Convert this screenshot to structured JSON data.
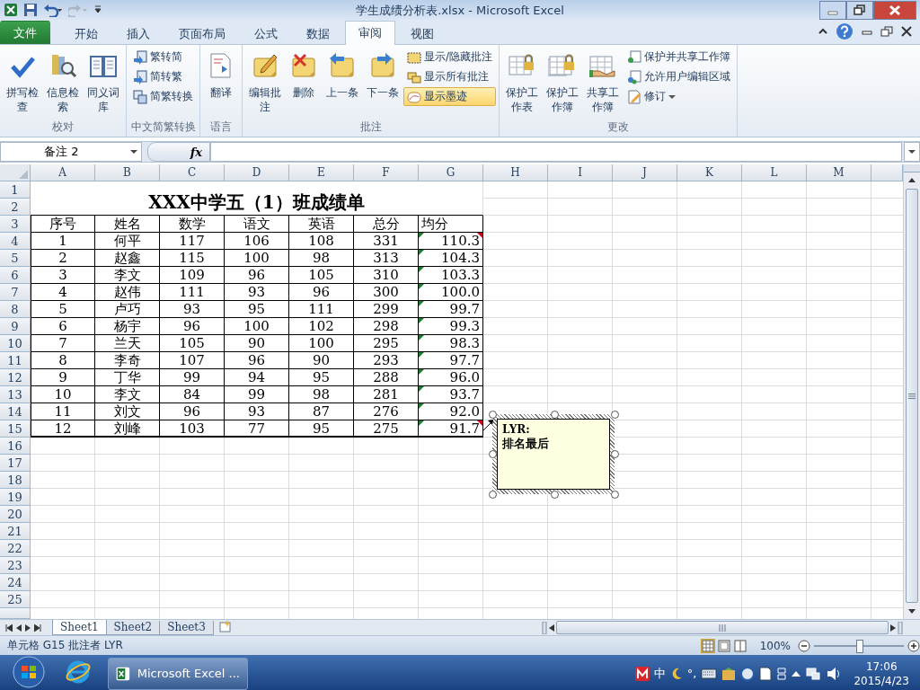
{
  "window": {
    "title": "学生成绩分析表.xlsx - Microsoft Excel"
  },
  "tabs": [
    {
      "label": "文件",
      "kind": "file",
      "selected": false
    },
    {
      "label": "开始",
      "kind": "tab",
      "selected": false
    },
    {
      "label": "插入",
      "kind": "tab",
      "selected": false
    },
    {
      "label": "页面布局",
      "kind": "tab",
      "selected": false
    },
    {
      "label": "公式",
      "kind": "tab",
      "selected": false
    },
    {
      "label": "数据",
      "kind": "tab",
      "selected": false
    },
    {
      "label": "审阅",
      "kind": "tab",
      "selected": true
    },
    {
      "label": "视图",
      "kind": "tab",
      "selected": false
    }
  ],
  "ribbon": {
    "groups": [
      {
        "label": "校对",
        "items": [
          {
            "kind": "large",
            "label": "拼写检查"
          },
          {
            "kind": "large",
            "label": "信息检索"
          },
          {
            "kind": "large",
            "label": "同义词库"
          }
        ]
      },
      {
        "label": "中文简繁转换",
        "items": [
          {
            "kind": "small",
            "label": "繁转简"
          },
          {
            "kind": "small",
            "label": "简转繁"
          },
          {
            "kind": "small",
            "label": "简繁转换"
          }
        ]
      },
      {
        "label": "语言",
        "items": [
          {
            "kind": "large",
            "label": "翻译"
          }
        ]
      },
      {
        "label": "批注",
        "items": [
          {
            "kind": "large",
            "label": "编辑批注"
          },
          {
            "kind": "large",
            "label": "删除"
          },
          {
            "kind": "large",
            "label": "上一条"
          },
          {
            "kind": "large",
            "label": "下一条"
          },
          {
            "kind": "toggle",
            "label": "显示/隐藏批注",
            "on": false
          },
          {
            "kind": "toggle",
            "label": "显示所有批注",
            "on": false
          },
          {
            "kind": "toggle",
            "label": "显示墨迹",
            "on": true
          }
        ]
      },
      {
        "label": "更改",
        "items": [
          {
            "kind": "large",
            "label": "保护工作表"
          },
          {
            "kind": "large",
            "label": "保护工作簿"
          },
          {
            "kind": "large",
            "label": "共享工作簿"
          },
          {
            "kind": "small",
            "label": "保护并共享工作簿"
          },
          {
            "kind": "small",
            "label": "允许用户编辑区域"
          },
          {
            "kind": "menu",
            "label": "修订"
          }
        ]
      }
    ]
  },
  "formula_bar": {
    "name_box": "备注 2",
    "function_label": "fx"
  },
  "sheet": {
    "columns": [
      "A",
      "B",
      "C",
      "D",
      "E",
      "F",
      "G",
      "H",
      "I",
      "J",
      "K",
      "L",
      "M"
    ],
    "rows": [
      "1",
      "2",
      "3",
      "4",
      "5",
      "6",
      "7",
      "8",
      "9",
      "10",
      "11",
      "12",
      "13",
      "14",
      "15",
      "16",
      "17",
      "18",
      "19",
      "20",
      "21",
      "22",
      "23",
      "24",
      "25"
    ],
    "title": "XXX中学五（1）班成绩单",
    "header": [
      "序号",
      "姓名",
      "数学",
      "语文",
      "英语",
      "总分",
      "均分"
    ],
    "records": [
      {
        "cells": [
          "1",
          "何平",
          "117",
          "106",
          "108",
          "331",
          "110.3"
        ],
        "text_number": true,
        "comment": true
      },
      {
        "cells": [
          "2",
          "赵鑫",
          "115",
          "100",
          "98",
          "313",
          "104.3"
        ],
        "text_number": true,
        "comment": false
      },
      {
        "cells": [
          "3",
          "李文",
          "109",
          "96",
          "105",
          "310",
          "103.3"
        ],
        "text_number": true,
        "comment": false
      },
      {
        "cells": [
          "4",
          "赵伟",
          "111",
          "93",
          "96",
          "300",
          "100.0"
        ],
        "text_number": true,
        "comment": false
      },
      {
        "cells": [
          "5",
          "卢巧",
          "93",
          "95",
          "111",
          "299",
          "99.7"
        ],
        "text_number": true,
        "comment": false
      },
      {
        "cells": [
          "6",
          "杨宇",
          "96",
          "100",
          "102",
          "298",
          "99.3"
        ],
        "text_number": true,
        "comment": false
      },
      {
        "cells": [
          "7",
          "兰天",
          "105",
          "90",
          "100",
          "295",
          "98.3"
        ],
        "text_number": true,
        "comment": false
      },
      {
        "cells": [
          "8",
          "李奇",
          "107",
          "96",
          "90",
          "293",
          "97.7"
        ],
        "text_number": true,
        "comment": false
      },
      {
        "cells": [
          "9",
          "丁华",
          "99",
          "94",
          "95",
          "288",
          "96.0"
        ],
        "text_number": true,
        "comment": false
      },
      {
        "cells": [
          "10",
          "李文",
          "84",
          "99",
          "98",
          "281",
          "93.7"
        ],
        "text_number": true,
        "comment": false
      },
      {
        "cells": [
          "11",
          "刘文",
          "96",
          "93",
          "87",
          "276",
          "92.0"
        ],
        "text_number": true,
        "comment": false
      },
      {
        "cells": [
          "12",
          "刘峰",
          "103",
          "77",
          "95",
          "275",
          "91.7"
        ],
        "text_number": true,
        "comment": true
      }
    ],
    "comment": {
      "author": "LYR:",
      "text": "排名最后"
    }
  },
  "sheet_tabs": [
    {
      "label": "Sheet1",
      "selected": true
    },
    {
      "label": "Sheet2",
      "selected": false
    },
    {
      "label": "Sheet3",
      "selected": false
    }
  ],
  "status_bar": {
    "text": "单元格 G15 批注者 LYR",
    "views": [
      {
        "selected": true
      },
      {
        "selected": false
      },
      {
        "selected": false
      }
    ],
    "zoom": "100%",
    "zoom_slider": {
      "level": 0.5
    }
  },
  "taskbar": {
    "tasks": [
      {
        "label": "Microsoft Excel ...",
        "selected": true
      }
    ],
    "ime": [
      "中",
      "°,"
    ],
    "time": "17:06",
    "date": "2015/4/23"
  }
}
